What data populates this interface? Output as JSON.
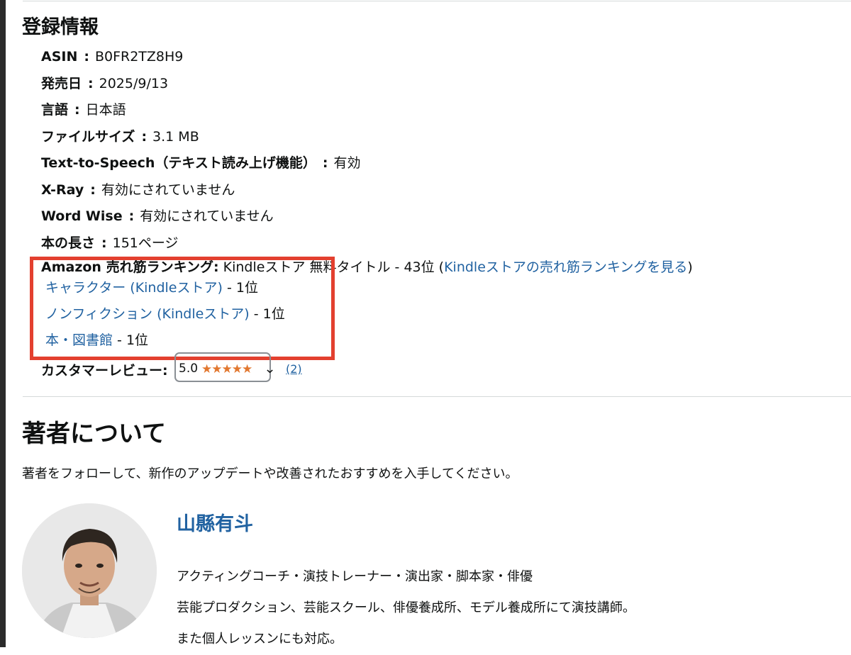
{
  "section_title": "登録情報",
  "details": [
    {
      "key": "ASIN",
      "value": "B0FR2TZ8H9"
    },
    {
      "key": "発売日",
      "value": "2025/9/13"
    },
    {
      "key": "言語",
      "value": "日本語"
    },
    {
      "key": "ファイルサイズ",
      "value": "3.1 MB"
    },
    {
      "key": "Text-to-Speech（テキスト読み上げ機能）",
      "value": "有効"
    },
    {
      "key": "X-Ray",
      "value": "有効にされていません"
    },
    {
      "key": "Word Wise",
      "value": "有効にされていません"
    },
    {
      "key": "本の長さ",
      "value": "151ページ"
    }
  ],
  "colon": ":",
  "ranking": {
    "label": "Amazon 売れ筋ランキング:",
    "text": "Kindleストア 無料タイトル - 43位 (",
    "link": "Kindleストアの売れ筋ランキングを見る",
    "close": ")",
    "subs": [
      {
        "link": "キャラクター (Kindleストア)",
        "rank": " - 1位"
      },
      {
        "link": "ノンフィクション (Kindleストア)",
        "rank": " - 1位"
      },
      {
        "link": "本・図書館",
        "rank": " - 1位"
      }
    ]
  },
  "reviews": {
    "label": "カスタマーレビュー:",
    "score": "5.0",
    "rating": 5,
    "count": "(2)"
  },
  "author_section": {
    "title": "著者について",
    "follow_text": "著者をフォローして、新作のアップデートや改善されたおすすめを入手してください。",
    "name": "山縣有斗",
    "bio": [
      "アクティングコーチ・演技トレーナー・演出家・脚本家・俳優",
      "芸能プロダクション、芸能スクール、俳優養成所、モデル養成所にて演技講師。",
      "また個人レッスンにも対応。"
    ]
  },
  "colors": {
    "link": "#2162a1",
    "star": "#e2772f",
    "highlight": "#e3402f"
  }
}
